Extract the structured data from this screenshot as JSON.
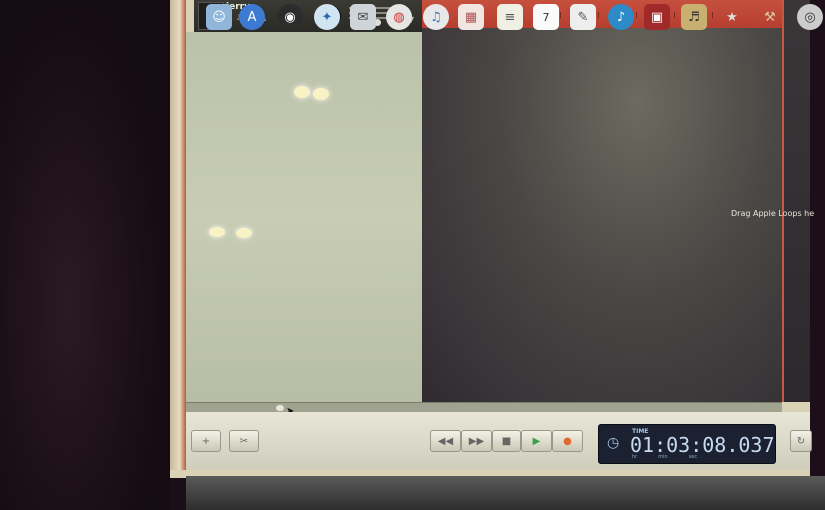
{
  "track": {
    "name": "jerry"
  },
  "arrange": {
    "drop_hint": "Drag Apple Loops he"
  },
  "transport": {
    "buttons": [
      {
        "name": "add-track-button",
        "glyph": "+"
      },
      {
        "name": "edit-button",
        "glyph": "✂"
      },
      {
        "name": "rewind-button",
        "glyph": "◀◀"
      },
      {
        "name": "fast-forward-button",
        "glyph": "▶▶"
      },
      {
        "name": "stop-button",
        "glyph": "■"
      },
      {
        "name": "play-button",
        "glyph": "▶"
      },
      {
        "name": "record-button",
        "glyph": "●"
      },
      {
        "name": "loop-button",
        "glyph": "↻"
      }
    ],
    "lcd": {
      "label": "TIME",
      "time": "01:03:08.037",
      "units": [
        "hr",
        "min",
        "sec"
      ]
    }
  },
  "dock": {
    "calendar_day": "7",
    "icons": [
      "finder-icon",
      "app-store-icon",
      "dashboard-icon",
      "safari-icon",
      "mail-icon",
      "chrome-icon",
      "itunes-store-icon",
      "photos-icon",
      "notes-icon",
      "calendar-icon",
      "preview-icon",
      "itunes-icon",
      "photobooth-icon",
      "garageband-icon",
      "imovie-icon",
      "folder-icon",
      "trash-icon"
    ]
  },
  "colors": {
    "timeline": "#c24a3a",
    "lcd_bg": "#1b2130",
    "lcd_text": "#c6dbf3",
    "play_green": "#3aa04a",
    "record_orange": "#e06a30"
  }
}
